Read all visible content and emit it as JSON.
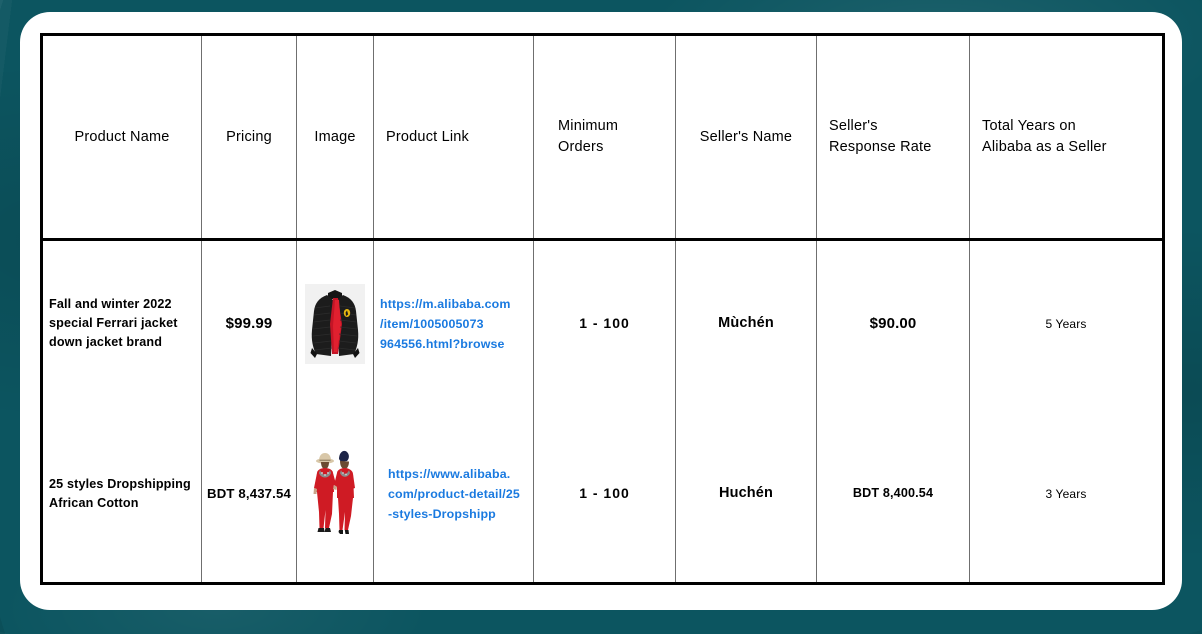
{
  "theme": {
    "background_color": "#0c5560",
    "card_color": "#ffffff",
    "table_border_color": "#000000",
    "grid_line_color": "#6f6f6f",
    "link_color": "#1a7ae0",
    "text_color": "#000000"
  },
  "table": {
    "columns": [
      {
        "id": "product_name",
        "label": "Product Name"
      },
      {
        "id": "pricing",
        "label": "Pricing"
      },
      {
        "id": "image",
        "label": "Image"
      },
      {
        "id": "product_link",
        "label": "Product Link"
      },
      {
        "id": "minimum_orders",
        "label": "Minimum\nOrders",
        "label_line1": "Minimum",
        "label_line2": "Orders"
      },
      {
        "id": "sellers_name",
        "label": "Seller's Name"
      },
      {
        "id": "response_rate",
        "label": "Seller's\nResponse Rate",
        "label_line1": "Seller's",
        "label_line2": "Response Rate"
      },
      {
        "id": "total_years",
        "label": "Total Years on\nAlibaba as a Seller",
        "label_line1": "Total Years on",
        "label_line2": "Alibaba as a Seller"
      }
    ],
    "rows": [
      {
        "product_name_line1": "Fall and winter 2022",
        "product_name_line2": "special Ferrari jacket",
        "product_name_line3": "down jacket brand",
        "pricing": "$99.99",
        "image_alt": "black-puffer-down-jacket-with-red-lining",
        "link_line1": "https://m.alibaba.com",
        "link_line2": "/item/1005005073",
        "link_line3": "964556.html?browse",
        "minimum_orders": "1 - 100",
        "sellers_name": "Mùchén",
        "response_rate": "$90.00",
        "total_years": "5 Years"
      },
      {
        "product_name_line1": "25 styles Dropshipping",
        "product_name_line2": "African Cotton",
        "product_name_line3": "",
        "pricing": "BDT 8,437.54",
        "image_alt": "two-people-wearing-red-african-cotton-outfits",
        "link_line1": "https://www.alibaba.",
        "link_line2": "com/product-detail/25",
        "link_line3": "-styles-Dropshipp",
        "minimum_orders": "1 - 100",
        "sellers_name": "Huchén",
        "response_rate": "BDT 8,400.54",
        "total_years": "3 Years"
      }
    ]
  }
}
